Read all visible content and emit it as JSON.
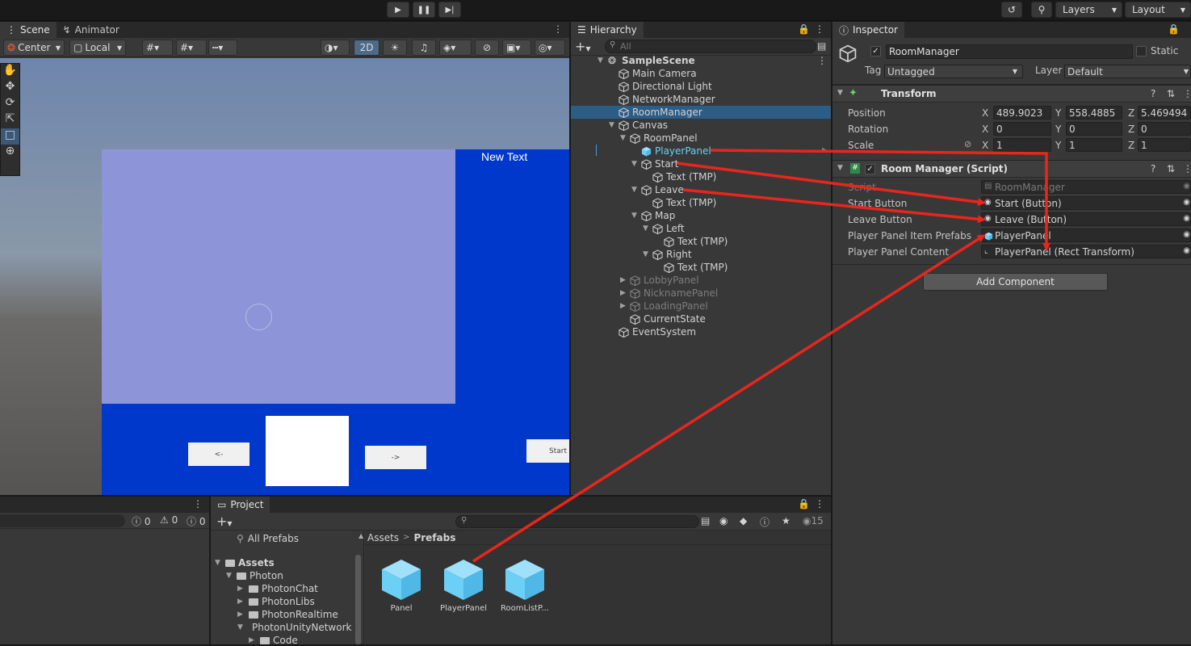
{
  "colors": {
    "accent_blue": "#2c5d87",
    "scene_blue": "#0038cc",
    "scene_panel": "#8d94d8",
    "prefab_blue": "#6ccff6",
    "arrow_red": "#e8261c"
  },
  "toolbar": {
    "layers_label": "Layers",
    "layout_label": "Layout",
    "play_icon": "play-icon",
    "pause_icon": "pause-icon",
    "step_icon": "step-icon"
  },
  "scene": {
    "tabs": [
      {
        "label": "Scene",
        "icon": "grid-icon"
      },
      {
        "label": "Animator",
        "icon": "animator-icon"
      }
    ],
    "pivot_label": "Center",
    "space_label": "Local",
    "mode_2d": "2D",
    "new_text": "New Text",
    "btn_left": "<-",
    "btn_right": "->",
    "btn_start": "Start"
  },
  "hierarchy": {
    "tab_label": "Hierarchy",
    "search_placeholder": "All",
    "items": [
      {
        "label": "SampleScene"
      },
      {
        "label": "Main Camera"
      },
      {
        "label": "Directional Light"
      },
      {
        "label": "NetworkManager"
      },
      {
        "label": "RoomManager"
      },
      {
        "label": "Canvas"
      },
      {
        "label": "RoomPanel"
      },
      {
        "label": "PlayerPanel"
      },
      {
        "label": "Start"
      },
      {
        "label": "Text (TMP)"
      },
      {
        "label": "Leave"
      },
      {
        "label": "Text (TMP)"
      },
      {
        "label": "Map"
      },
      {
        "label": "Left"
      },
      {
        "label": "Text (TMP)"
      },
      {
        "label": "Right"
      },
      {
        "label": "Text (TMP)"
      },
      {
        "label": "LobbyPanel"
      },
      {
        "label": "NicknamePanel"
      },
      {
        "label": "LoadingPanel"
      },
      {
        "label": "CurrentState"
      },
      {
        "label": "EventSystem"
      }
    ]
  },
  "inspector": {
    "tab_label": "Inspector",
    "object_name": "RoomManager",
    "static_label": "Static",
    "tag_label": "Tag",
    "tag_value": "Untagged",
    "layer_label": "Layer",
    "layer_value": "Default",
    "transform": {
      "title": "Transform",
      "position_label": "Position",
      "pos_x": "489.9023",
      "pos_y": "558.4885",
      "pos_z": "5.469494",
      "rotation_label": "Rotation",
      "rot_x": "0",
      "rot_y": "0",
      "rot_z": "0",
      "scale_label": "Scale",
      "scl_x": "1",
      "scl_y": "1",
      "scl_z": "1",
      "x": "X",
      "y": "Y",
      "z": "Z"
    },
    "script": {
      "title": "Room Manager (Script)",
      "fields": [
        {
          "label": "Script",
          "value": "RoomManager"
        },
        {
          "label": "Start Button",
          "value": "Start (Button)"
        },
        {
          "label": "Leave Button",
          "value": "Leave (Button)"
        },
        {
          "label": "Player Panel Item Prefabs",
          "value": "PlayerPanel"
        },
        {
          "label": "Player Panel Content",
          "value": "PlayerPanel (Rect Transform)"
        }
      ]
    },
    "add_component": "Add Component"
  },
  "console": {
    "count_info": "0",
    "count_warn": "0",
    "count_error": "0"
  },
  "project": {
    "tab_label": "Project",
    "hidden_count": "15",
    "all_prefabs": "All Prefabs",
    "breadcrumb_root": "Assets",
    "breadcrumb_current": "Prefabs",
    "tree": [
      {
        "label": "Assets"
      },
      {
        "label": "Photon"
      },
      {
        "label": "PhotonChat"
      },
      {
        "label": "PhotonLibs"
      },
      {
        "label": "PhotonRealtime"
      },
      {
        "label": "PhotonUnityNetworking"
      },
      {
        "label": "Code"
      }
    ],
    "assets": [
      {
        "label": "Panel"
      },
      {
        "label": "PlayerPanel"
      },
      {
        "label": "RoomListP..."
      }
    ]
  }
}
